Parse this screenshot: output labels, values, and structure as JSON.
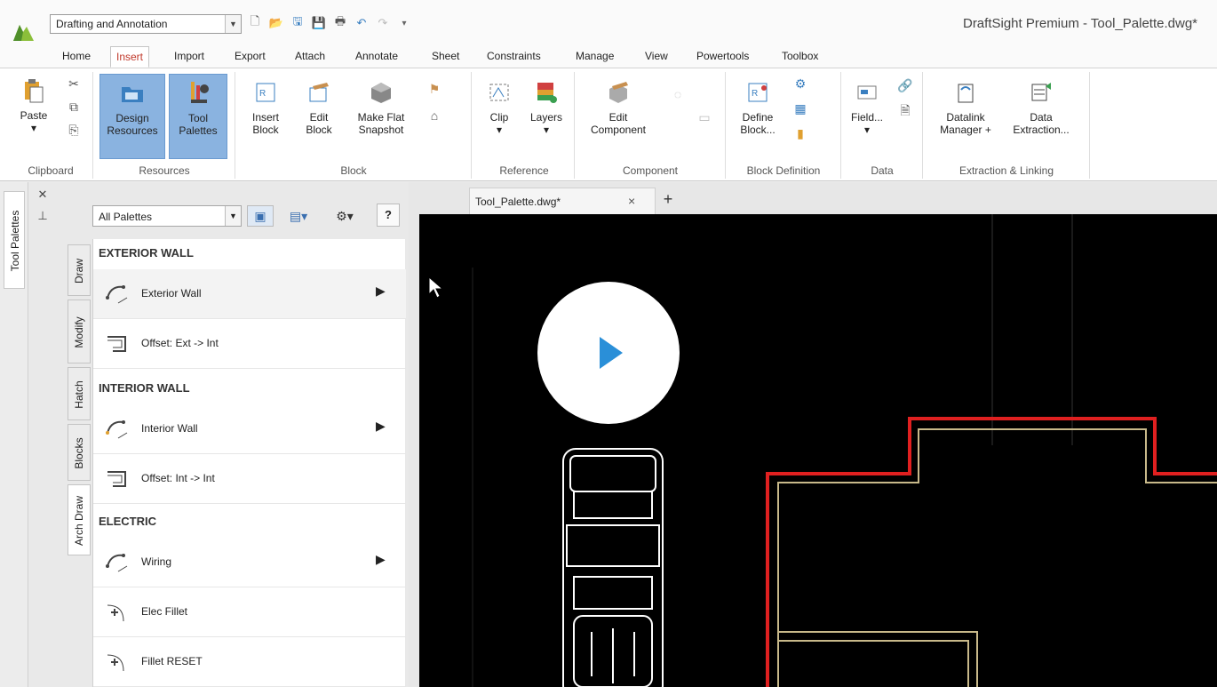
{
  "window": {
    "title": "DraftSight Premium - Tool_Palette.dwg*",
    "workspace": "Drafting and Annotation"
  },
  "ribbon_tabs": [
    "Home",
    "Insert",
    "Import",
    "Export",
    "Attach",
    "Annotate",
    "Sheet",
    "Constraints",
    "Manage",
    "View",
    "Powertools",
    "Toolbox"
  ],
  "active_tab": "Insert",
  "ribbon": {
    "clipboard": {
      "label": "Clipboard",
      "paste": "Paste"
    },
    "resources": {
      "label": "Resources",
      "design_resources": [
        "Design",
        "Resources"
      ],
      "tool_palettes": [
        "Tool",
        "Palettes"
      ]
    },
    "block": {
      "label": "Block",
      "insert_block": [
        "Insert",
        "Block"
      ],
      "edit_block": [
        "Edit",
        "Block"
      ],
      "make_flat_snapshot": [
        "Make Flat",
        "Snapshot"
      ]
    },
    "reference": {
      "label": "Reference",
      "clip": "Clip",
      "layers": "Layers"
    },
    "component": {
      "label": "Component",
      "edit_component": [
        "Edit",
        "Component"
      ]
    },
    "block_definition": {
      "label": "Block Definition",
      "define_block": [
        "Define",
        "Block..."
      ]
    },
    "data": {
      "label": "Data",
      "field": "Field..."
    },
    "extraction": {
      "label": "Extraction & Linking",
      "datalink_manager": [
        "Datalink",
        "Manager +"
      ],
      "data_extraction": [
        "Data",
        "Extraction..."
      ]
    }
  },
  "side_panel_tab": "Tool Palettes",
  "palette": {
    "selector": "All Palettes",
    "help": "?",
    "vertical_tabs": [
      "Draw",
      "Modify",
      "Hatch",
      "Blocks",
      "Arch Draw"
    ],
    "active_vertical_tab": "Arch Draw",
    "sections": [
      {
        "title": "EXTERIOR WALL",
        "tools": [
          {
            "label": "Exterior Wall",
            "flyout": true
          },
          {
            "label": "Offset: Ext -> Int",
            "flyout": false
          }
        ]
      },
      {
        "title": "INTERIOR WALL",
        "tools": [
          {
            "label": "Interior Wall",
            "flyout": true
          },
          {
            "label": "Offset: Int -> Int",
            "flyout": false
          }
        ]
      },
      {
        "title": "ELECTRIC",
        "tools": [
          {
            "label": "Wiring",
            "flyout": true
          },
          {
            "label": "Elec Fillet",
            "flyout": false
          },
          {
            "label": "Fillet RESET",
            "flyout": false
          }
        ]
      }
    ]
  },
  "document_tab": {
    "name": "Tool_Palette.dwg*",
    "close": "×",
    "new": "+"
  },
  "colors": {
    "accent_tab": "#c0392b",
    "selected_button": "#8ab3e0",
    "play": "#2a8fd8",
    "wall_red": "#e02020",
    "wall_tan": "#c8b98a"
  }
}
